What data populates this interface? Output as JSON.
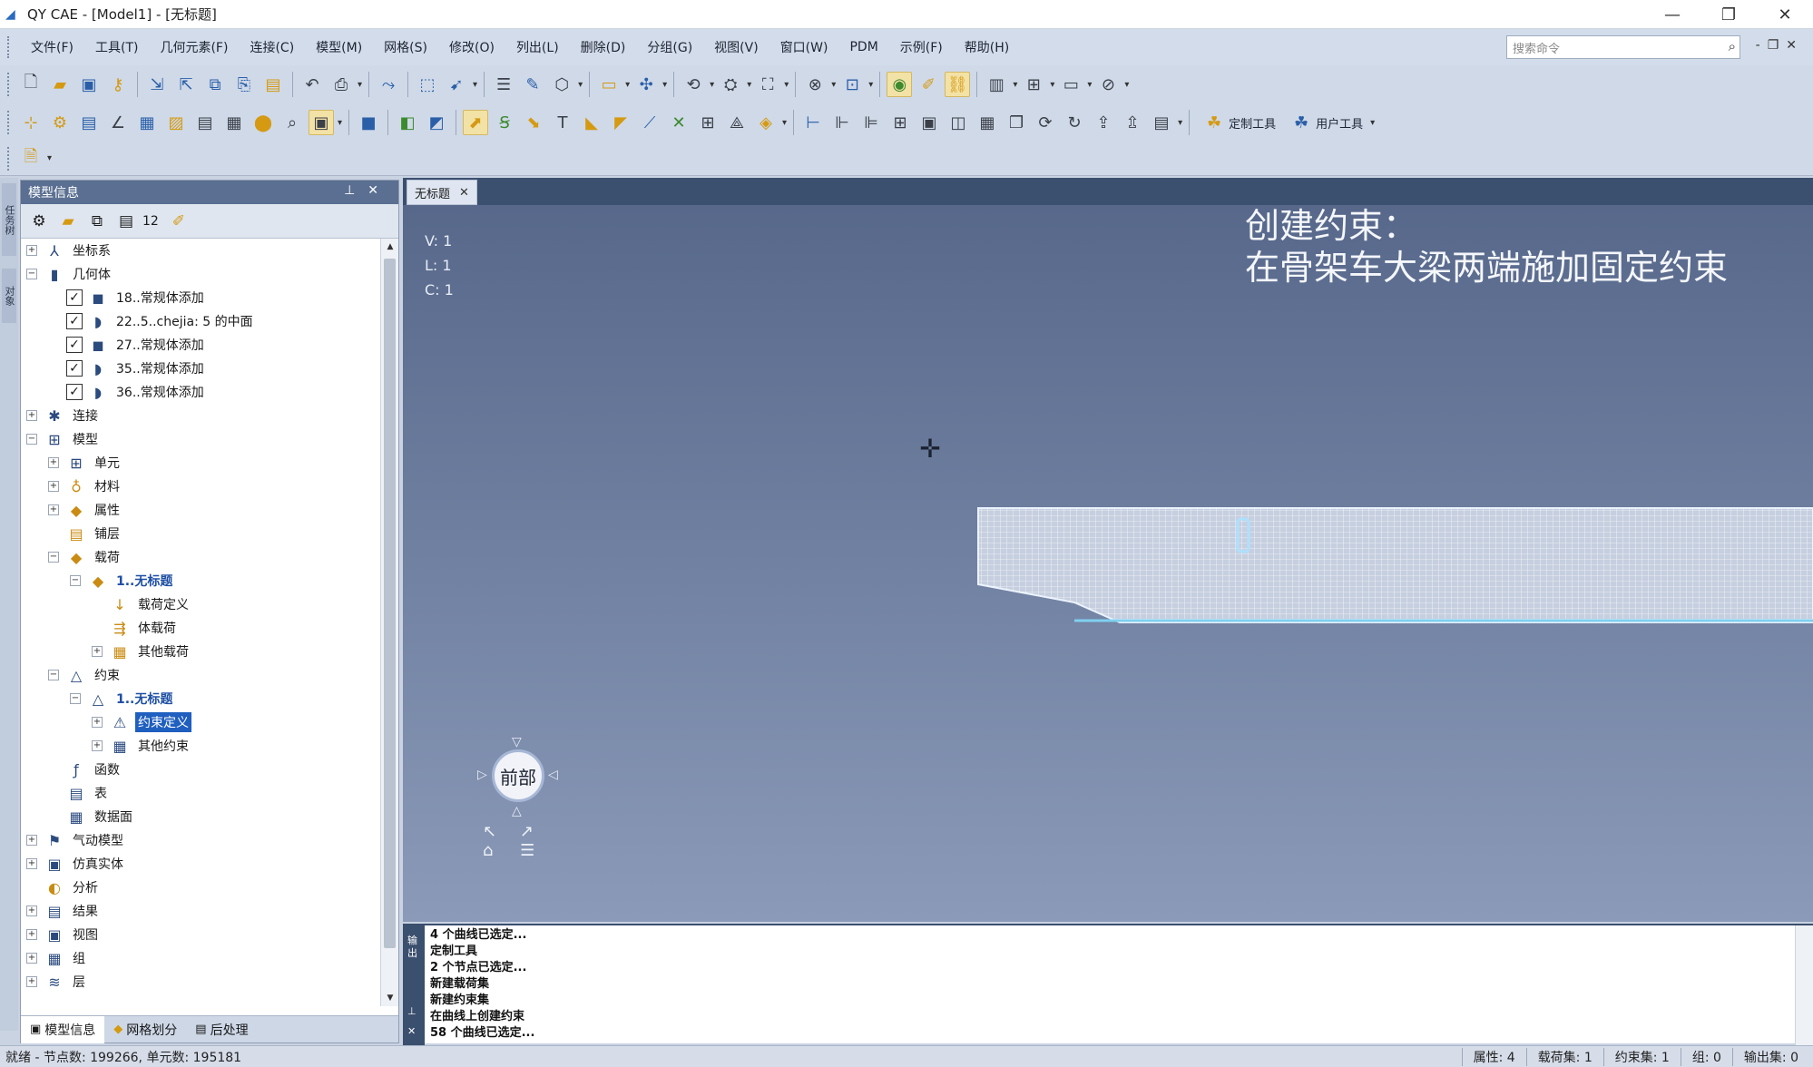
{
  "window": {
    "title": "QY CAE - [Model1] - [无标题]",
    "buttons": [
      "—",
      "❐",
      "✕"
    ]
  },
  "menu": {
    "items": [
      "文件(F)",
      "工具(T)",
      "几何元素(F)",
      "连接(C)",
      "模型(M)",
      "网格(S)",
      "修改(O)",
      "列出(L)",
      "删除(D)",
      "分组(G)",
      "视图(V)",
      "窗口(W)",
      "PDM",
      "示例(F)",
      "帮助(H)"
    ],
    "search_placeholder": "搜索命令"
  },
  "toolbar3": {
    "custom_tools_label": "定制工具",
    "user_tools_label": "用户工具"
  },
  "left_strip": {
    "tab1": "任务树",
    "tab2": "对象"
  },
  "panel": {
    "title": "模型信息",
    "tool_number": "12",
    "tree": [
      {
        "label": "坐标系",
        "level": 0,
        "expander": "+",
        "icon": "axis-icon"
      },
      {
        "label": "几何体",
        "level": 0,
        "expander": "−",
        "icon": "geometry-icon"
      },
      {
        "label": "18..常规体添加",
        "level": 1,
        "expander": "",
        "checked": true,
        "icon": "solid-icon"
      },
      {
        "label": "22..5..chejia: 5 的中面",
        "level": 1,
        "expander": "",
        "checked": true,
        "icon": "shell-icon"
      },
      {
        "label": "27..常规体添加",
        "level": 1,
        "expander": "",
        "checked": true,
        "icon": "solid-icon"
      },
      {
        "label": "35..常规体添加",
        "level": 1,
        "expander": "",
        "checked": true,
        "icon": "shell-icon"
      },
      {
        "label": "36..常规体添加",
        "level": 1,
        "expander": "",
        "checked": true,
        "icon": "shell-icon"
      },
      {
        "label": "连接",
        "level": 0,
        "expander": "+",
        "icon": "connection-icon"
      },
      {
        "label": "模型",
        "level": 0,
        "expander": "−",
        "icon": "model-icon"
      },
      {
        "label": "单元",
        "level": 1,
        "expander": "+",
        "icon": "element-icon"
      },
      {
        "label": "材料",
        "level": 1,
        "expander": "+",
        "icon": "material-icon"
      },
      {
        "label": "属性",
        "level": 1,
        "expander": "+",
        "icon": "property-icon"
      },
      {
        "label": "铺层",
        "level": 1,
        "expander": "",
        "icon": "layup-icon"
      },
      {
        "label": "载荷",
        "level": 1,
        "expander": "−",
        "icon": "load-icon"
      },
      {
        "label": "1..无标题",
        "level": 2,
        "expander": "−",
        "icon": "load-set-icon",
        "style": "blue"
      },
      {
        "label": "载荷定义",
        "level": 3,
        "expander": "",
        "icon": "load-def-icon"
      },
      {
        "label": "体载荷",
        "level": 3,
        "expander": "",
        "icon": "body-load-icon"
      },
      {
        "label": "其他载荷",
        "level": 3,
        "expander": "+",
        "icon": "other-load-icon"
      },
      {
        "label": "约束",
        "level": 1,
        "expander": "−",
        "icon": "constraint-icon"
      },
      {
        "label": "1..无标题",
        "level": 2,
        "expander": "−",
        "icon": "constraint-set-icon",
        "style": "blue"
      },
      {
        "label": "约束定义",
        "level": 3,
        "expander": "+",
        "icon": "constraint-def-icon",
        "style": "selected"
      },
      {
        "label": "其他约束",
        "level": 3,
        "expander": "+",
        "icon": "other-constraint-icon"
      },
      {
        "label": "函数",
        "level": 1,
        "expander": "",
        "icon": "function-icon"
      },
      {
        "label": "表",
        "level": 1,
        "expander": "",
        "icon": "table-icon"
      },
      {
        "label": "数据面",
        "level": 1,
        "expander": "",
        "icon": "data-surface-icon"
      },
      {
        "label": "气动模型",
        "level": 0,
        "expander": "+",
        "icon": "aero-icon"
      },
      {
        "label": "仿真实体",
        "level": 0,
        "expander": "+",
        "icon": "sim-entity-icon"
      },
      {
        "label": "分析",
        "level": 0,
        "expander": "",
        "icon": "analysis-icon"
      },
      {
        "label": "结果",
        "level": 0,
        "expander": "+",
        "icon": "results-icon"
      },
      {
        "label": "视图",
        "level": 0,
        "expander": "+",
        "icon": "view-icon"
      },
      {
        "label": "组",
        "level": 0,
        "expander": "+",
        "icon": "group-icon"
      },
      {
        "label": "层",
        "level": 0,
        "expander": "+",
        "icon": "layer-icon"
      }
    ],
    "tabs": [
      "模型信息",
      "网格划分",
      "后处理"
    ]
  },
  "document": {
    "tab_label": "无标题"
  },
  "viewport": {
    "counts": [
      "V: 1",
      "L: 1",
      "C: 1"
    ],
    "annotation_line1": "创建约束：",
    "annotation_line2": "在骨架车大梁两端施加固定约束",
    "view_label": "前部"
  },
  "output": {
    "side_labels": [
      "输",
      "出"
    ],
    "lines": [
      "4 个曲线已选定...",
      "定制工具",
      "2 个节点已选定...",
      "新建载荷集",
      "新建约束集",
      "在曲线上创建约束",
      "58 个曲线已选定..."
    ]
  },
  "status": {
    "left": "就绪 - 节点数: 199266, 单元数: 195181",
    "right": [
      "属性: 4",
      "载荷集: 1",
      "约束集: 1",
      "组: 0",
      "输出集: 0"
    ]
  }
}
